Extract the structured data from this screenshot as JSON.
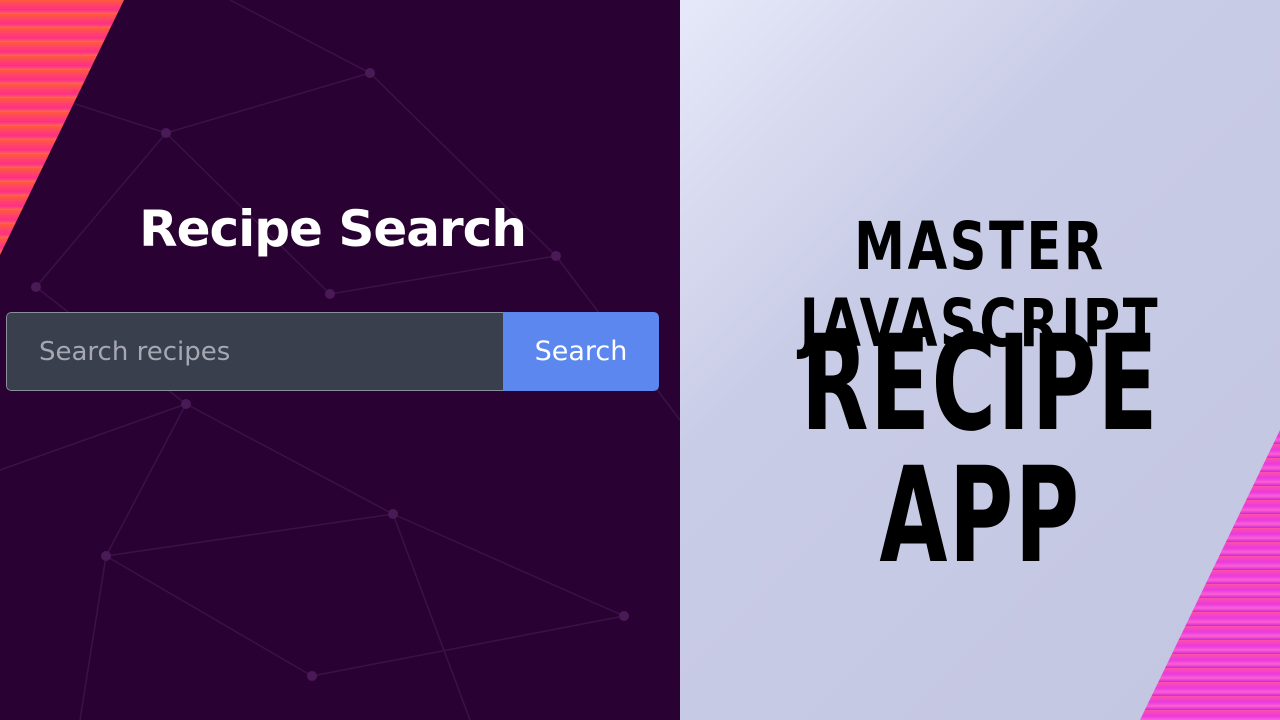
{
  "app": {
    "title": "Recipe Search"
  },
  "search": {
    "placeholder": "Search recipes",
    "value": "",
    "button_label": "Search"
  },
  "banner": {
    "line1": "MASTER JAVASCRIPT",
    "line2": "RECIPE APP"
  },
  "colors": {
    "left_background": "#290233",
    "input_background": "#3a3f4e",
    "button_accent": "#5b87ef",
    "right_background": "#c9cce6",
    "stripe_left": "#ff3f6e",
    "stripe_right": "#e83ae0"
  }
}
